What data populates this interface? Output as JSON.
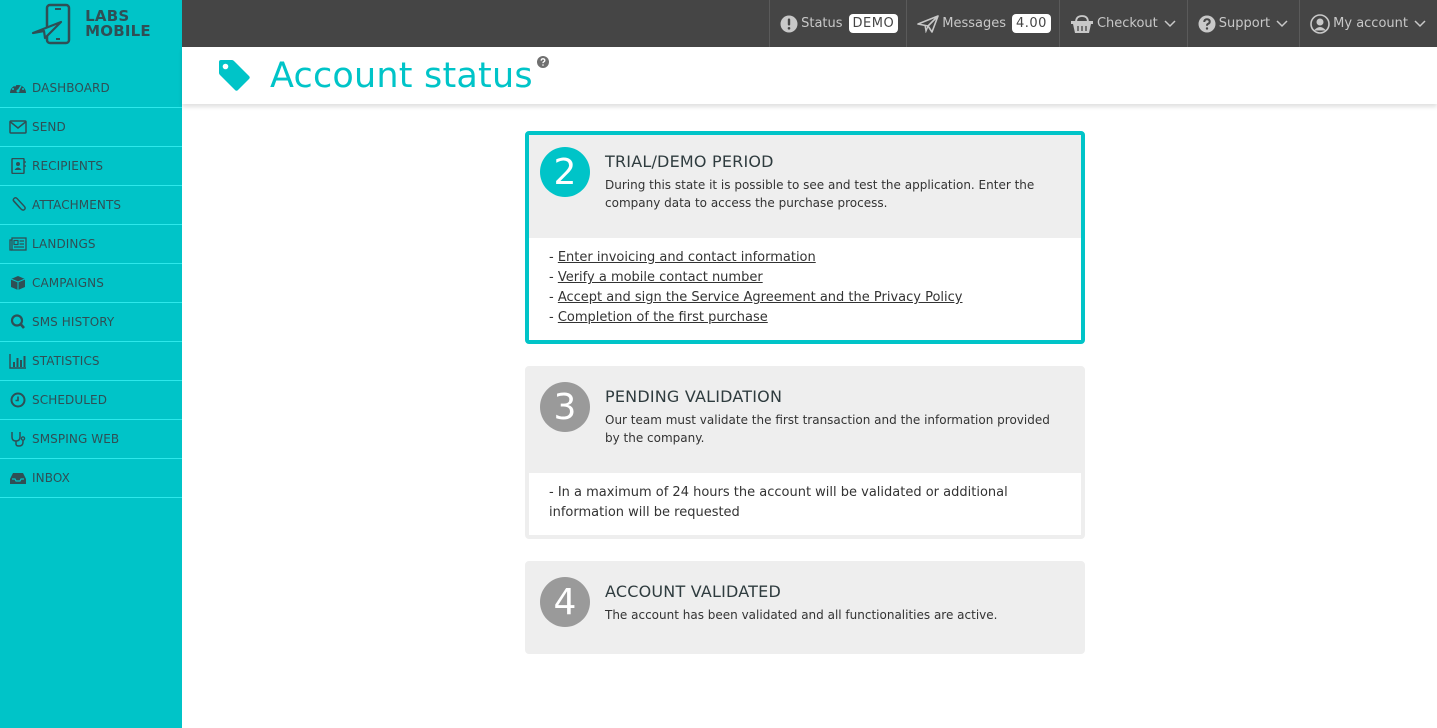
{
  "brand": {
    "line1": "LABS",
    "line2": "MOBILE"
  },
  "sidebar": {
    "items": [
      {
        "label": "DASHBOARD",
        "icon": "dashboard-icon"
      },
      {
        "label": "SEND",
        "icon": "envelope-icon"
      },
      {
        "label": "RECIPIENTS",
        "icon": "address-book-icon"
      },
      {
        "label": "ATTACHMENTS",
        "icon": "paperclip-icon"
      },
      {
        "label": "LANDINGS",
        "icon": "newspaper-icon"
      },
      {
        "label": "CAMPAIGNS",
        "icon": "cube-icon"
      },
      {
        "label": "SMS HISTORY",
        "icon": "search-icon"
      },
      {
        "label": "STATISTICS",
        "icon": "bar-chart-icon"
      },
      {
        "label": "SCHEDULED",
        "icon": "clock-icon"
      },
      {
        "label": "SMSPING WEB",
        "icon": "stethoscope-icon"
      },
      {
        "label": "INBOX",
        "icon": "inbox-icon"
      }
    ]
  },
  "topbar": {
    "status_label": "Status",
    "status_value": "DEMO",
    "messages_label": "Messages",
    "messages_value": "4.00",
    "checkout_label": "Checkout",
    "support_label": "Support",
    "account_label": "My account"
  },
  "page": {
    "title": "Account status"
  },
  "steps": [
    {
      "number": "2",
      "title": "TRIAL/DEMO PERIOD",
      "description": "During this state it is possible to see and test the application. Enter the company data to access the purchase process.",
      "state": "active",
      "links": [
        "Enter invoicing and contact information",
        "Verify a mobile contact number",
        "Accept and sign the Service Agreement and the Privacy Policy",
        "Completion of the first purchase"
      ]
    },
    {
      "number": "3",
      "title": "PENDING VALIDATION",
      "description": "Our team must validate the first transaction and the information provided by the company.",
      "state": "inactive",
      "note": "- In a maximum of 24 hours the account will be validated or additional information will be requested"
    },
    {
      "number": "4",
      "title": "ACCOUNT VALIDATED",
      "description": "The account has been validated and all functionalities are active.",
      "state": "inactive"
    }
  ],
  "colors": {
    "accent": "#00c4c8",
    "topbar": "#454545",
    "sidebar_text": "#2f4f55",
    "panel": "#eeeeee",
    "inactive_circle": "#9a9a9a"
  }
}
